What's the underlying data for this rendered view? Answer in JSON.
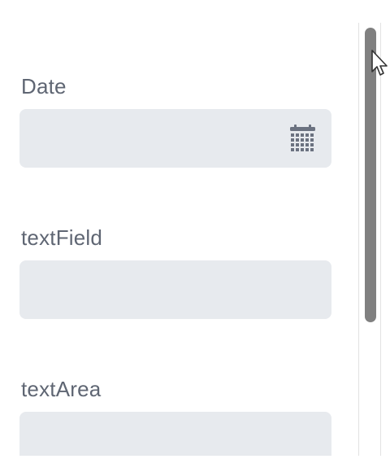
{
  "form": {
    "fields": [
      {
        "label": "Date",
        "value": "",
        "type": "date",
        "icon": "calendar-icon"
      },
      {
        "label": "textField",
        "value": "",
        "type": "text"
      },
      {
        "label": "textArea",
        "value": "",
        "type": "textarea"
      }
    ]
  },
  "colors": {
    "label_text": "#5f6673",
    "input_background": "#e7eaee",
    "scrollbar_thumb": "#808080",
    "calendar_icon": "#6b7280"
  },
  "scrollbar": {
    "position_fraction": 0.0
  }
}
